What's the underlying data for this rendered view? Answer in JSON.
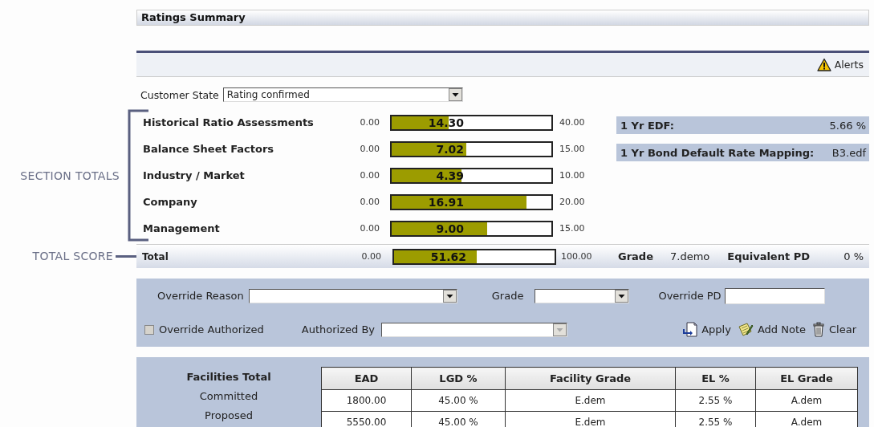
{
  "panel": {
    "title": "Ratings Summary",
    "alerts_label": "Alerts"
  },
  "customer_state": {
    "label": "Customer State",
    "value": "Rating confirmed"
  },
  "annotations": {
    "section_totals": "SECTION TOTALS",
    "total_score": "TOTAL SCORE"
  },
  "sections": [
    {
      "name": "Historical Ratio Assessments",
      "min": "0.00",
      "value": "14.30",
      "max": "40.00",
      "level": 0.3575
    },
    {
      "name": "Balance Sheet Factors",
      "min": "0.00",
      "value": "7.02",
      "max": "15.00",
      "level": 0.468
    },
    {
      "name": "Industry / Market",
      "min": "0.00",
      "value": "4.39",
      "max": "10.00",
      "level": 0.439
    },
    {
      "name": "Company",
      "min": "0.00",
      "value": "16.91",
      "max": "20.00",
      "level": 0.8455
    },
    {
      "name": "Management",
      "min": "0.00",
      "value": "9.00",
      "max": "15.00",
      "level": 0.6
    }
  ],
  "edf": [
    {
      "label": "1 Yr EDF:",
      "value": "5.66 %"
    },
    {
      "label": "1 Yr Bond Default Rate Mapping:",
      "value": "B3.edf"
    }
  ],
  "total": {
    "name": "Total",
    "min": "0.00",
    "value": "51.62",
    "max": "100.00",
    "level": 0.5162,
    "grade_label": "Grade",
    "grade": "7.demo",
    "pd_label": "Equivalent PD",
    "pd": "0 %"
  },
  "override": {
    "reason_label": "Override Reason",
    "grade_label": "Grade",
    "pd_label": "Override PD",
    "authorized": {
      "label": "Override Authorized",
      "checked": false,
      "disabled": true
    },
    "authorized_by": {
      "label": "Authorized By",
      "disabled": true
    },
    "actions": [
      {
        "kind": "apply",
        "label": "Apply"
      },
      {
        "kind": "note",
        "label": "Add Note"
      },
      {
        "kind": "clear",
        "label": "Clear"
      }
    ]
  },
  "facilities": {
    "title": "Facilities Total",
    "row_labels": [
      "Committed",
      "Proposed"
    ],
    "table": {
      "columns": [
        "EAD",
        "LGD %",
        "Facility Grade",
        "EL %",
        "EL Grade"
      ],
      "rows": [
        [
          "1800.00",
          "45.00 %",
          "E.dem",
          "2.55 %",
          "A.dem"
        ],
        [
          "5550.00",
          "45.00 %",
          "E.dem",
          "2.55 %",
          "A.dem"
        ]
      ]
    }
  }
}
